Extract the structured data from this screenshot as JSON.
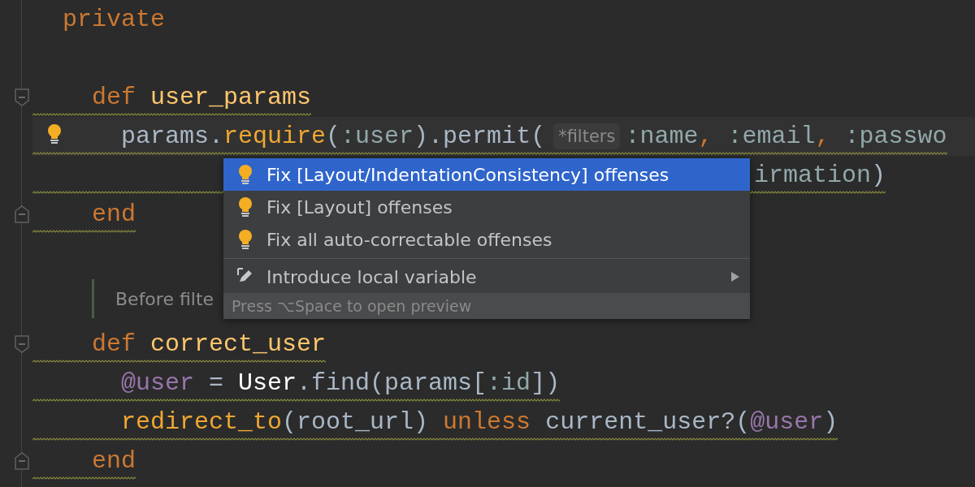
{
  "editor": {
    "lines": [
      {
        "kind": "code",
        "tokens": [
          {
            "text": "private",
            "kind": "keyword"
          }
        ]
      },
      {
        "kind": "blank"
      },
      {
        "kind": "code",
        "fold_open": true,
        "squiggle": true,
        "tokens": [
          {
            "text": "  def ",
            "kind": "keyword"
          },
          {
            "text": "user_params",
            "kind": "method"
          }
        ]
      },
      {
        "kind": "code",
        "highlighted": true,
        "bulb": true,
        "squiggle": true,
        "tokens": [
          {
            "text": "    params.",
            "kind": "plain"
          },
          {
            "text": "require",
            "kind": "call"
          },
          {
            "text": "(",
            "kind": "plain"
          },
          {
            "text": ":user",
            "kind": "symbol"
          },
          {
            "text": ").permit(",
            "kind": "plain"
          },
          {
            "text": "*filters",
            "kind": "hint"
          },
          {
            "text": ":name",
            "kind": "symbol"
          },
          {
            "text": ", ",
            "kind": "comma"
          },
          {
            "text": ":email",
            "kind": "symbol"
          },
          {
            "text": ", ",
            "kind": "comma"
          },
          {
            "text": ":passwo",
            "kind": "symbol"
          }
        ]
      },
      {
        "kind": "continuation",
        "squiggle": true,
        "tokens": [
          {
            "text": "irmation",
            "kind": "symbol"
          },
          {
            "text": ")",
            "kind": "plain"
          }
        ]
      },
      {
        "kind": "code",
        "fold_close": true,
        "squiggle": true,
        "tokens": [
          {
            "text": "  end",
            "kind": "keyword"
          }
        ]
      },
      {
        "kind": "blank"
      },
      {
        "kind": "doc",
        "text": "Before filte"
      },
      {
        "kind": "code",
        "fold_open": true,
        "squiggle": true,
        "tokens": [
          {
            "text": "  def ",
            "kind": "keyword"
          },
          {
            "text": "correct_user",
            "kind": "method"
          }
        ]
      },
      {
        "kind": "code",
        "squiggle": true,
        "tokens": [
          {
            "text": "    @user",
            "kind": "ivar"
          },
          {
            "text": " = ",
            "kind": "plain"
          },
          {
            "text": "User",
            "kind": "const"
          },
          {
            "text": ".find(params[",
            "kind": "plain"
          },
          {
            "text": ":id",
            "kind": "symbol"
          },
          {
            "text": "])",
            "kind": "plain"
          }
        ]
      },
      {
        "kind": "code",
        "squiggle": true,
        "tokens": [
          {
            "text": "    redirect_to",
            "kind": "call"
          },
          {
            "text": "(root_url) ",
            "kind": "plain"
          },
          {
            "text": "unless",
            "kind": "keyword"
          },
          {
            "text": " current_user?(",
            "kind": "plain"
          },
          {
            "text": "@user",
            "kind": "ivar"
          },
          {
            "text": ")",
            "kind": "plain"
          }
        ]
      },
      {
        "kind": "code",
        "fold_close": true,
        "squiggle": true,
        "tokens": [
          {
            "text": "  end",
            "kind": "keyword"
          }
        ]
      }
    ]
  },
  "popup": {
    "items": [
      {
        "label": "Fix [Layout/IndentationConsistency] offenses",
        "kind": "quick_fix",
        "selected": true
      },
      {
        "label": "Fix [Layout] offenses",
        "kind": "quick_fix",
        "selected": false
      },
      {
        "label": "Fix all auto-correctable offenses",
        "kind": "quick_fix",
        "selected": false
      },
      {
        "label": "Introduce local variable",
        "kind": "refactoring",
        "selected": false,
        "separator_before": true,
        "submenu": true
      }
    ],
    "footer": "Press ⌥Space to open preview"
  }
}
